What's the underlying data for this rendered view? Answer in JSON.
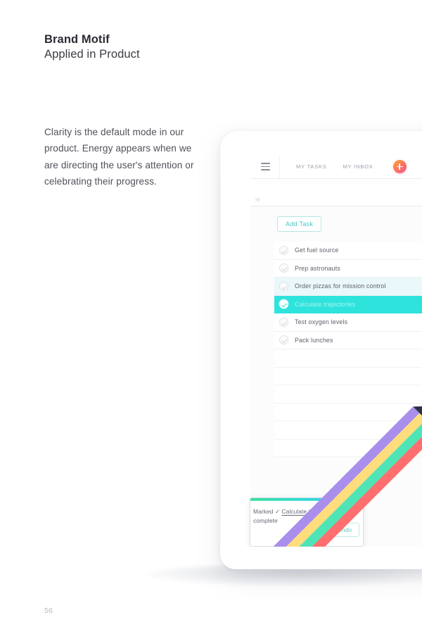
{
  "page": {
    "heading_main": "Brand Motif",
    "heading_sub": "Applied in Product",
    "body_copy": "Clarity is the default mode in our product. Energy appears when we are directing the user's attention or celebrating their progress.",
    "page_number": "56",
    "background": "#ffffff"
  },
  "app": {
    "header": {
      "menu_icon": "hamburger-menu-icon",
      "nav": [
        {
          "label": "MY TASKS"
        },
        {
          "label": "MY INBOX"
        }
      ],
      "add_button": {
        "label": "+",
        "icon": "plus-icon",
        "gradient_from": "#FF9E3D",
        "gradient_to": "#F0598E"
      }
    },
    "sub_bar": {
      "icon": "sun-icon"
    },
    "list": {
      "add_task_label": "Add Task",
      "accent": "#49c8c4",
      "highlight_color": "#2fe3dd",
      "hover_color": "#eaf7fb",
      "tasks": [
        {
          "label": "Get fuel source",
          "state": "default"
        },
        {
          "label": "Prep astronauts",
          "state": "default"
        },
        {
          "label": "Order pizzas for mission control",
          "state": "hover"
        },
        {
          "label": "Calculate trajectories",
          "state": "done"
        },
        {
          "label": "Test oxygen levels",
          "state": "default"
        },
        {
          "label": "Pack lunches",
          "state": "default"
        }
      ],
      "empty_rows": 6
    },
    "toast": {
      "text_prefix": "Marked ✓ ",
      "text_task": "Calculate trajectories",
      "text_suffix": " complete",
      "undo_label": "Undo",
      "bar_gradient_from": "#3fe0a0",
      "bar_gradient_to": "#3fc3e8"
    }
  },
  "motif": {
    "name": "rainbow-beam",
    "stripes": [
      {
        "name": "purple",
        "color": "#a98eec"
      },
      {
        "name": "yellow",
        "color": "#ffdd7d"
      },
      {
        "name": "mint",
        "color": "#4fe4b6"
      },
      {
        "name": "coral",
        "color": "#ff6f6f"
      }
    ],
    "tip_color": "#2e3046"
  }
}
